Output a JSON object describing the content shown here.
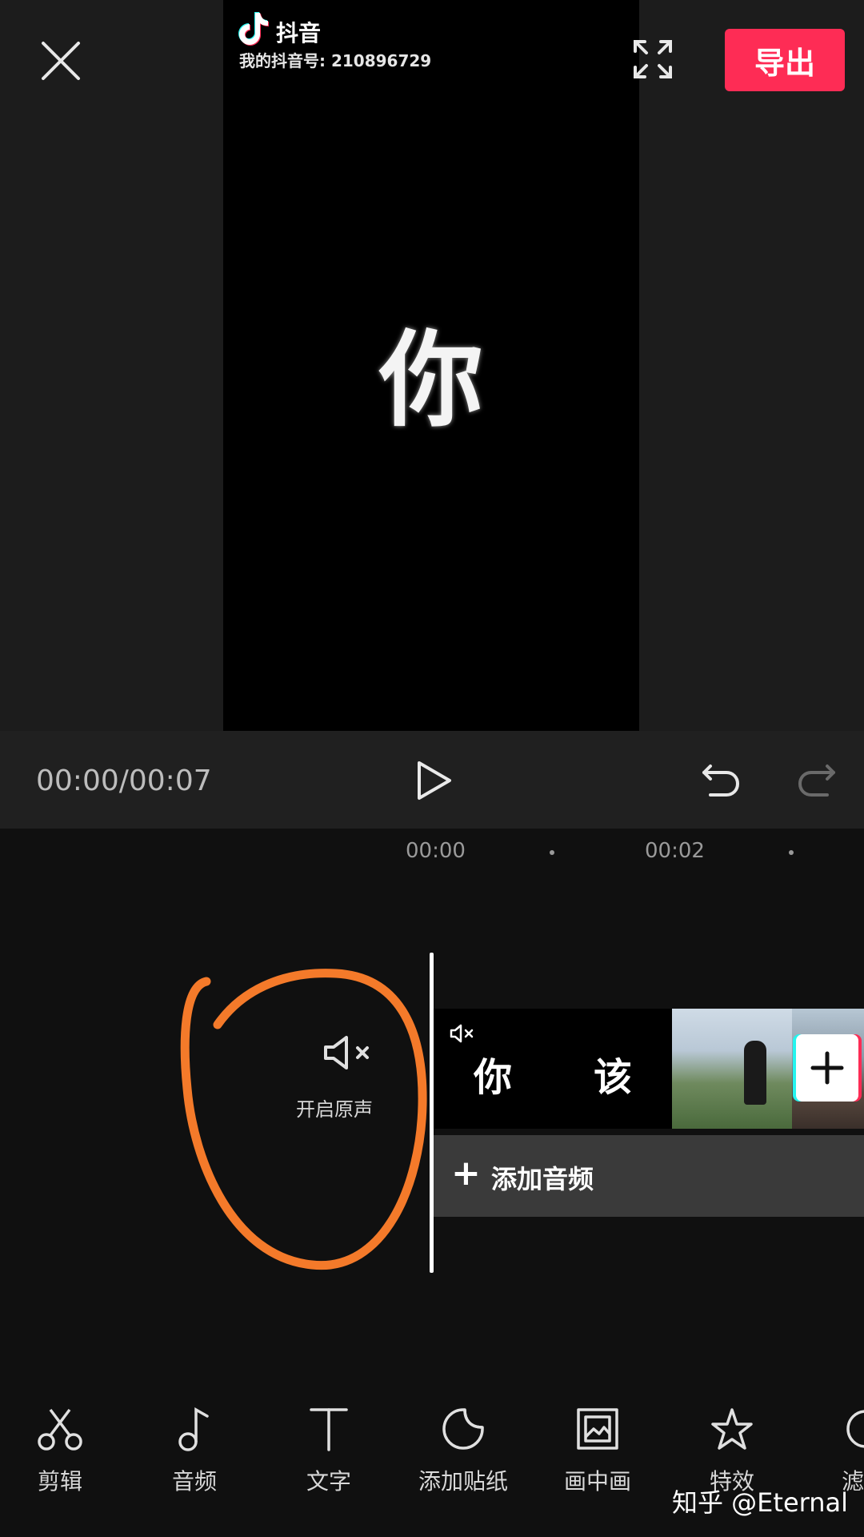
{
  "video": {
    "brand_name": "抖音",
    "account_id_text": "我的抖音号: 210896729",
    "frame_char": "你"
  },
  "header": {
    "export_label": "导出"
  },
  "playback": {
    "time_readout": "00:00/00:07"
  },
  "timeline": {
    "ruler_labels": [
      "00:00",
      "00:02"
    ],
    "audio_toggle_label": "开启原声",
    "clip_text_1": "你",
    "clip_text_2": "该",
    "add_audio_label": "添加音频"
  },
  "toolbar": {
    "items": [
      {
        "label": "剪辑",
        "icon": "scissors-icon"
      },
      {
        "label": "音频",
        "icon": "music-note-icon"
      },
      {
        "label": "文字",
        "icon": "text-icon"
      },
      {
        "label": "添加贴纸",
        "icon": "sticker-icon"
      },
      {
        "label": "画中画",
        "icon": "picture-in-picture-icon"
      },
      {
        "label": "特效",
        "icon": "star-effect-icon"
      },
      {
        "label": "滤",
        "icon": "filter-icon"
      }
    ]
  },
  "watermark": "知乎 @Eternal",
  "colors": {
    "accent": "#fe2c55",
    "annotation": "#f47a2a",
    "background": "#101010"
  }
}
